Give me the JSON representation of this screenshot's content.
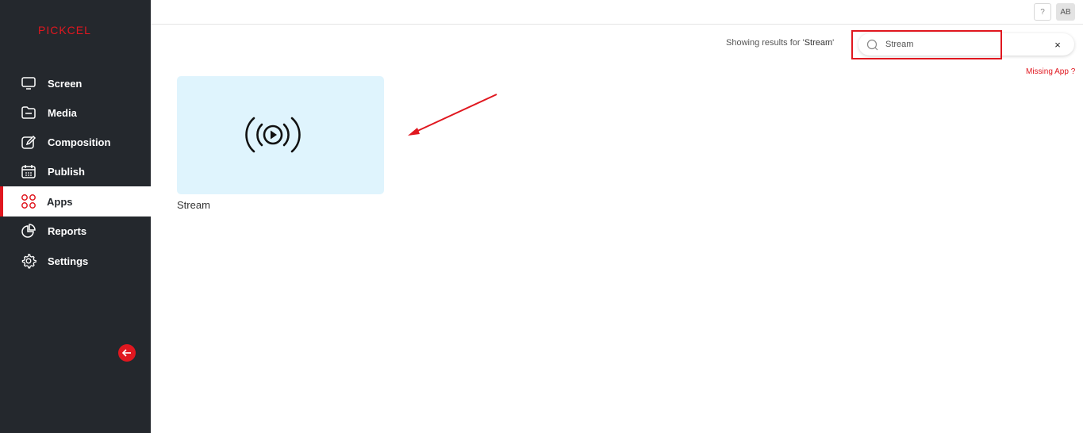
{
  "brand": {
    "logo_text": "PICKCEL",
    "accent_color": "#e0171f",
    "sidebar_bg": "#24282d"
  },
  "sidebar": {
    "items": [
      {
        "label": "Screen",
        "icon": "monitor-icon"
      },
      {
        "label": "Media",
        "icon": "folder-icon"
      },
      {
        "label": "Composition",
        "icon": "edit-icon"
      },
      {
        "label": "Publish",
        "icon": "calendar-icon"
      },
      {
        "label": "Apps",
        "icon": "apps-grid-icon",
        "active": true
      },
      {
        "label": "Reports",
        "icon": "pie-chart-icon"
      },
      {
        "label": "Settings",
        "icon": "gear-icon"
      }
    ],
    "collapse_icon": "arrow-left-icon"
  },
  "topbar": {
    "help_label": "?",
    "avatar_initials": "AB"
  },
  "search": {
    "results_prefix": "Showing results for '",
    "query": "Stream",
    "results_suffix": "'",
    "value": "Stream",
    "clear_label": "×"
  },
  "missing_app_label": "Missing App ?",
  "apps": [
    {
      "name": "Stream",
      "icon": "broadcast-play-icon",
      "card_color": "#dff4fd"
    }
  ]
}
